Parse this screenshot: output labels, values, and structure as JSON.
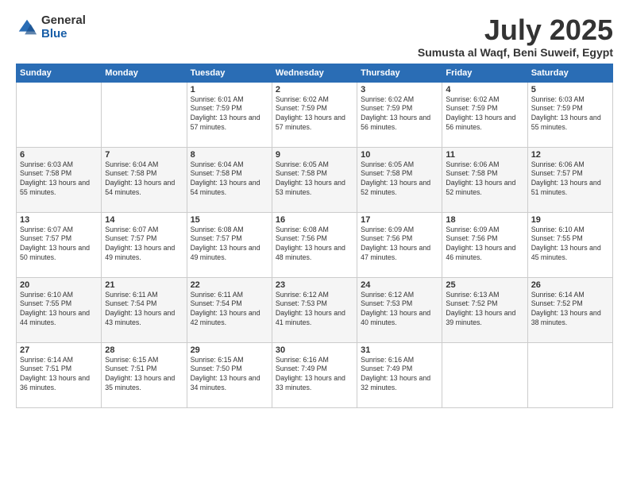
{
  "logo": {
    "general": "General",
    "blue": "Blue"
  },
  "title": "July 2025",
  "location": "Sumusta al Waqf, Beni Suweif, Egypt",
  "days_of_week": [
    "Sunday",
    "Monday",
    "Tuesday",
    "Wednesday",
    "Thursday",
    "Friday",
    "Saturday"
  ],
  "weeks": [
    [
      {
        "day": "",
        "sunrise": "",
        "sunset": "",
        "daylight": ""
      },
      {
        "day": "",
        "sunrise": "",
        "sunset": "",
        "daylight": ""
      },
      {
        "day": "1",
        "sunrise": "Sunrise: 6:01 AM",
        "sunset": "Sunset: 7:59 PM",
        "daylight": "Daylight: 13 hours and 57 minutes."
      },
      {
        "day": "2",
        "sunrise": "Sunrise: 6:02 AM",
        "sunset": "Sunset: 7:59 PM",
        "daylight": "Daylight: 13 hours and 57 minutes."
      },
      {
        "day": "3",
        "sunrise": "Sunrise: 6:02 AM",
        "sunset": "Sunset: 7:59 PM",
        "daylight": "Daylight: 13 hours and 56 minutes."
      },
      {
        "day": "4",
        "sunrise": "Sunrise: 6:02 AM",
        "sunset": "Sunset: 7:59 PM",
        "daylight": "Daylight: 13 hours and 56 minutes."
      },
      {
        "day": "5",
        "sunrise": "Sunrise: 6:03 AM",
        "sunset": "Sunset: 7:59 PM",
        "daylight": "Daylight: 13 hours and 55 minutes."
      }
    ],
    [
      {
        "day": "6",
        "sunrise": "Sunrise: 6:03 AM",
        "sunset": "Sunset: 7:58 PM",
        "daylight": "Daylight: 13 hours and 55 minutes."
      },
      {
        "day": "7",
        "sunrise": "Sunrise: 6:04 AM",
        "sunset": "Sunset: 7:58 PM",
        "daylight": "Daylight: 13 hours and 54 minutes."
      },
      {
        "day": "8",
        "sunrise": "Sunrise: 6:04 AM",
        "sunset": "Sunset: 7:58 PM",
        "daylight": "Daylight: 13 hours and 54 minutes."
      },
      {
        "day": "9",
        "sunrise": "Sunrise: 6:05 AM",
        "sunset": "Sunset: 7:58 PM",
        "daylight": "Daylight: 13 hours and 53 minutes."
      },
      {
        "day": "10",
        "sunrise": "Sunrise: 6:05 AM",
        "sunset": "Sunset: 7:58 PM",
        "daylight": "Daylight: 13 hours and 52 minutes."
      },
      {
        "day": "11",
        "sunrise": "Sunrise: 6:06 AM",
        "sunset": "Sunset: 7:58 PM",
        "daylight": "Daylight: 13 hours and 52 minutes."
      },
      {
        "day": "12",
        "sunrise": "Sunrise: 6:06 AM",
        "sunset": "Sunset: 7:57 PM",
        "daylight": "Daylight: 13 hours and 51 minutes."
      }
    ],
    [
      {
        "day": "13",
        "sunrise": "Sunrise: 6:07 AM",
        "sunset": "Sunset: 7:57 PM",
        "daylight": "Daylight: 13 hours and 50 minutes."
      },
      {
        "day": "14",
        "sunrise": "Sunrise: 6:07 AM",
        "sunset": "Sunset: 7:57 PM",
        "daylight": "Daylight: 13 hours and 49 minutes."
      },
      {
        "day": "15",
        "sunrise": "Sunrise: 6:08 AM",
        "sunset": "Sunset: 7:57 PM",
        "daylight": "Daylight: 13 hours and 49 minutes."
      },
      {
        "day": "16",
        "sunrise": "Sunrise: 6:08 AM",
        "sunset": "Sunset: 7:56 PM",
        "daylight": "Daylight: 13 hours and 48 minutes."
      },
      {
        "day": "17",
        "sunrise": "Sunrise: 6:09 AM",
        "sunset": "Sunset: 7:56 PM",
        "daylight": "Daylight: 13 hours and 47 minutes."
      },
      {
        "day": "18",
        "sunrise": "Sunrise: 6:09 AM",
        "sunset": "Sunset: 7:56 PM",
        "daylight": "Daylight: 13 hours and 46 minutes."
      },
      {
        "day": "19",
        "sunrise": "Sunrise: 6:10 AM",
        "sunset": "Sunset: 7:55 PM",
        "daylight": "Daylight: 13 hours and 45 minutes."
      }
    ],
    [
      {
        "day": "20",
        "sunrise": "Sunrise: 6:10 AM",
        "sunset": "Sunset: 7:55 PM",
        "daylight": "Daylight: 13 hours and 44 minutes."
      },
      {
        "day": "21",
        "sunrise": "Sunrise: 6:11 AM",
        "sunset": "Sunset: 7:54 PM",
        "daylight": "Daylight: 13 hours and 43 minutes."
      },
      {
        "day": "22",
        "sunrise": "Sunrise: 6:11 AM",
        "sunset": "Sunset: 7:54 PM",
        "daylight": "Daylight: 13 hours and 42 minutes."
      },
      {
        "day": "23",
        "sunrise": "Sunrise: 6:12 AM",
        "sunset": "Sunset: 7:53 PM",
        "daylight": "Daylight: 13 hours and 41 minutes."
      },
      {
        "day": "24",
        "sunrise": "Sunrise: 6:12 AM",
        "sunset": "Sunset: 7:53 PM",
        "daylight": "Daylight: 13 hours and 40 minutes."
      },
      {
        "day": "25",
        "sunrise": "Sunrise: 6:13 AM",
        "sunset": "Sunset: 7:52 PM",
        "daylight": "Daylight: 13 hours and 39 minutes."
      },
      {
        "day": "26",
        "sunrise": "Sunrise: 6:14 AM",
        "sunset": "Sunset: 7:52 PM",
        "daylight": "Daylight: 13 hours and 38 minutes."
      }
    ],
    [
      {
        "day": "27",
        "sunrise": "Sunrise: 6:14 AM",
        "sunset": "Sunset: 7:51 PM",
        "daylight": "Daylight: 13 hours and 36 minutes."
      },
      {
        "day": "28",
        "sunrise": "Sunrise: 6:15 AM",
        "sunset": "Sunset: 7:51 PM",
        "daylight": "Daylight: 13 hours and 35 minutes."
      },
      {
        "day": "29",
        "sunrise": "Sunrise: 6:15 AM",
        "sunset": "Sunset: 7:50 PM",
        "daylight": "Daylight: 13 hours and 34 minutes."
      },
      {
        "day": "30",
        "sunrise": "Sunrise: 6:16 AM",
        "sunset": "Sunset: 7:49 PM",
        "daylight": "Daylight: 13 hours and 33 minutes."
      },
      {
        "day": "31",
        "sunrise": "Sunrise: 6:16 AM",
        "sunset": "Sunset: 7:49 PM",
        "daylight": "Daylight: 13 hours and 32 minutes."
      },
      {
        "day": "",
        "sunrise": "",
        "sunset": "",
        "daylight": ""
      },
      {
        "day": "",
        "sunrise": "",
        "sunset": "",
        "daylight": ""
      }
    ]
  ]
}
